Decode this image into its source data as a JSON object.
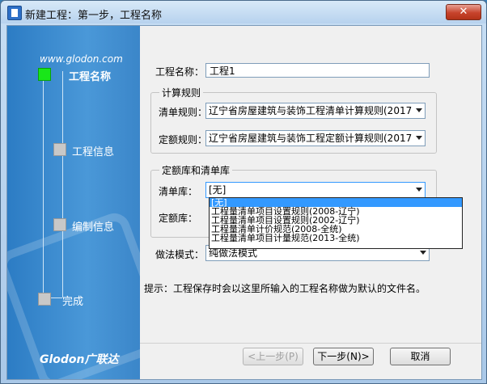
{
  "window": {
    "title": "新建工程：第一步，工程名称",
    "close_label": "✕"
  },
  "nav": {
    "url": "www.glodon.com",
    "steps": [
      {
        "label": "工程名称",
        "active": true
      },
      {
        "label": "工程信息",
        "active": false
      },
      {
        "label": "编制信息",
        "active": false
      },
      {
        "label": "完成",
        "active": false
      }
    ],
    "logo": "Glodon广联达"
  },
  "form": {
    "project_name": {
      "label": "工程名称：",
      "value": "工程1"
    },
    "calc_rules": {
      "title": "计算规则",
      "list_rule": {
        "label": "清单规则：",
        "value": "辽宁省房屋建筑与装饰工程清单计算规则(2017"
      },
      "quota_rule": {
        "label": "定额规则：",
        "value": "辽宁省房屋建筑与装饰工程定额计算规则(2017"
      }
    },
    "libraries": {
      "title": "定额库和清单库",
      "list_lib": {
        "label": "清单库：",
        "value": "[无]"
      },
      "quota_lib": {
        "label": "定额库："
      },
      "options": [
        "[无]",
        "工程量清单项目设置规则(2008-辽宁)",
        "工程量清单项目设置规则(2002-辽宁)",
        "工程量清单计价规范(2008-全统)",
        "工程量清单项目计量规范(2013-全统)"
      ]
    },
    "method": {
      "label": "做法模式：",
      "value": "纯做法模式"
    },
    "hint": "提示：工程保存时会以这里所输入的工程名称做为默认的文件名。"
  },
  "buttons": {
    "prev": "<上一步(P)",
    "next": "下一步(N)>",
    "cancel": "取消"
  }
}
